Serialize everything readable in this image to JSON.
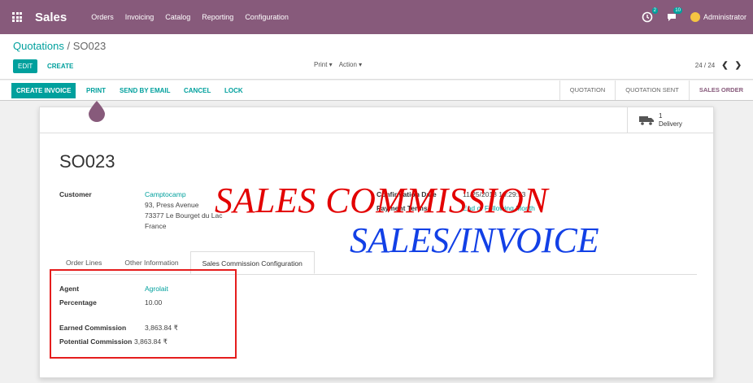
{
  "navbar": {
    "brand": "Sales",
    "menu": [
      "Orders",
      "Invoicing",
      "Catalog",
      "Reporting",
      "Configuration"
    ],
    "activity_badge": "2",
    "messages_badge": "10",
    "user": "Administrator"
  },
  "control_panel": {
    "breadcrumb_parent": "Quotations",
    "breadcrumb_sep": "/",
    "breadcrumb_current": "SO023",
    "edit_label": "EDIT",
    "create_label": "CREATE",
    "print_dd": "Print ▾",
    "action_dd": "Action ▾",
    "pager": "24 / 24",
    "prev": "❮",
    "next": "❯"
  },
  "statusbar": {
    "create_invoice": "CREATE INVOICE",
    "print": "PRINT",
    "send_email": "SEND BY EMAIL",
    "cancel": "CANCEL",
    "lock": "LOCK",
    "stages": [
      "QUOTATION",
      "QUOTATION SENT",
      "SALES ORDER"
    ],
    "active_stage": "SALES ORDER"
  },
  "sheet": {
    "delivery_count": "1",
    "delivery_label": "Delivery",
    "title": "SO023",
    "customer_label": "Customer",
    "customer_name": "Camptocamp",
    "addr1": "93, Press Avenue",
    "addr2": "73377 Le Bourget du Lac",
    "addr3": "France",
    "conf_date_label": "Confirmation Date",
    "conf_date": "11/25/2018 10:29:53",
    "payment_terms_label": "Payment Terms",
    "payment_terms": "End of Following Month",
    "tabs": [
      "Order Lines",
      "Other Information",
      "Sales Commission Configuration"
    ],
    "agent_label": "Agent",
    "agent": "Agrolait",
    "percentage_label": "Percentage",
    "percentage": "10.00",
    "earned_label": "Earned Commission",
    "earned": "3,863.84 ₹",
    "potential_label": "Potential Commission",
    "potential": "3,863.84 ₹"
  },
  "overlay": {
    "line1": "SALES  COMMISSION",
    "line2": "SALES/INVOICE"
  },
  "colors": {
    "brand": "#875a7b",
    "accent": "#00a09d",
    "highlight_red": "#e30000",
    "highlight_blue": "#1240e6"
  }
}
